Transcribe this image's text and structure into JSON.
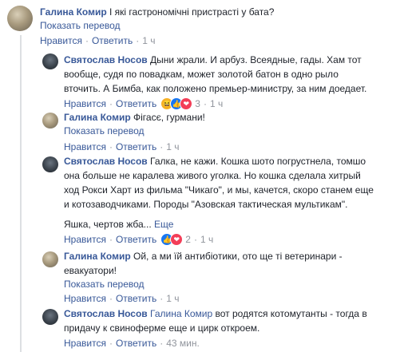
{
  "comments": [
    {
      "author": "Галина Комир",
      "text_lines": [
        "І які гастрономічні пристрасті у бата?"
      ],
      "translate": "Показать перевод",
      "like": "Нравится",
      "reply": "Ответить",
      "time": "1 ч"
    },
    {
      "author": "Святослав Носов",
      "text_lines": [
        "Дыни жрали. И арбуз. Всеядные, гады. Хам тот",
        "вообще, судя по повадкам, может золотой батон в одно рыло",
        "вточить. А Бимба, как положено премьер-министру, за ним доедает."
      ],
      "like": "Нравится",
      "reply": "Ответить",
      "reactions": [
        "haha",
        "like",
        "love"
      ],
      "reaction_count": "3",
      "time": "1 ч"
    },
    {
      "author": "Галина Комир",
      "text_lines": [
        "Фігасє, гурмани!"
      ],
      "translate": "Показать перевод",
      "like": "Нравится",
      "reply": "Ответить",
      "time": "1 ч"
    },
    {
      "author": "Святослав Носов",
      "text_lines": [
        "Галка, не кажи. Кошка шото погрустнела, томшо",
        "она больше не каралева живого уголка. Но кошка сделала хитрый",
        "ход Рокси Харт из фильма \"Чикаго\", и мы, качется, скоро станем еще",
        "и котозаводчиками. Породы \"Азовская тактическая мультикам\"."
      ],
      "extra_line": "Яшка, чертов жба...",
      "more": "Еще",
      "like": "Нравится",
      "reply": "Ответить",
      "reactions": [
        "like",
        "love"
      ],
      "reaction_count": "2",
      "time": "1 ч"
    },
    {
      "author": "Галина Комир",
      "text_lines": [
        "Ой, а ми їй антибіотики, ото ще ті ветеринари -",
        "евакуатори!"
      ],
      "translate": "Показать перевод",
      "like": "Нравится",
      "reply": "Ответить",
      "time": "1 ч"
    },
    {
      "author": "Святослав Носов",
      "mention": "Галина Комир",
      "text_lines": [
        "вот родятся котомутанты - тогда в",
        "придачу к свиноферме еще и цирк откроем."
      ],
      "like": "Нравится",
      "reply": "Ответить",
      "time": "43 мин."
    }
  ],
  "colors": {
    "link": "#385898",
    "meta": "#90949c",
    "text": "#1d2129",
    "thread_line": "#dddfe2"
  },
  "icons": {
    "haha": "😆",
    "like": "👍",
    "love": "❤"
  }
}
